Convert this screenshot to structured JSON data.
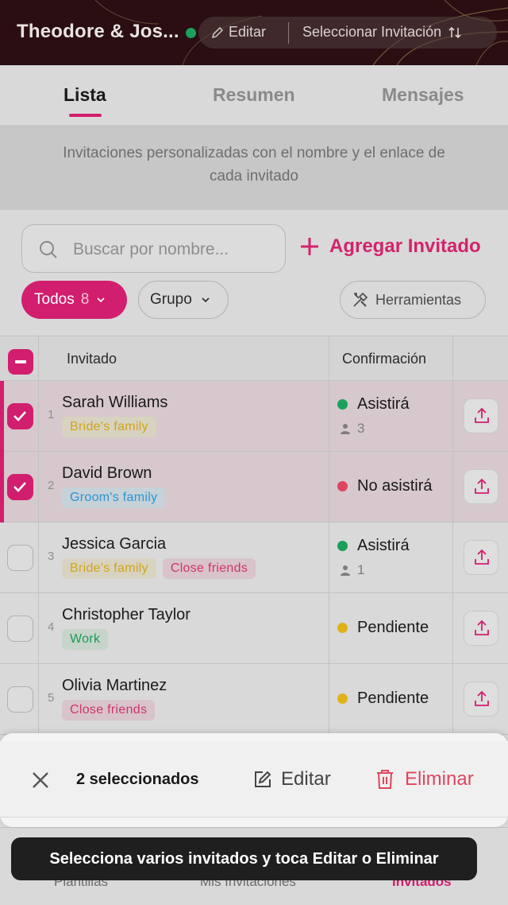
{
  "header": {
    "title": "Theodore & Jos...",
    "edit_label": "Editar",
    "select_invitation_label": "Seleccionar Invitación",
    "status_color": "#1aa05a"
  },
  "tabs": [
    {
      "label": "Lista",
      "active": true
    },
    {
      "label": "Resumen",
      "active": false
    },
    {
      "label": "Mensajes",
      "active": false
    }
  ],
  "description": {
    "line1": "Invitaciones personalizadas con el nombre y el enlace de",
    "line2": "cada invitado"
  },
  "search": {
    "placeholder": "Buscar por nombre..."
  },
  "add_guest_label": "Agregar Invitado",
  "filters": {
    "todos_label": "Todos",
    "todos_count": "8",
    "grupo_label": "Grupo",
    "tools_label": "Herramientas"
  },
  "table": {
    "headers": {
      "guest": "Invitado",
      "confirmation": "Confirmación"
    },
    "rows": [
      {
        "num": "1",
        "name": "Sarah Williams",
        "tags": [
          "Bride's family"
        ],
        "status": "Asistirá",
        "people": "3",
        "selected": true
      },
      {
        "num": "2",
        "name": "David Brown",
        "tags": [
          "Groom's family"
        ],
        "status": "No asistirá",
        "people": "",
        "selected": true
      },
      {
        "num": "3",
        "name": "Jessica Garcia",
        "tags": [
          "Bride's family",
          "Close friends"
        ],
        "status": "Asistirá",
        "people": "1",
        "selected": false
      },
      {
        "num": "4",
        "name": "Christopher Taylor",
        "tags": [
          "Work"
        ],
        "status": "Pendiente",
        "people": "",
        "selected": false
      },
      {
        "num": "5",
        "name": "Olivia Martinez",
        "tags": [
          "Close friends"
        ],
        "status": "Pendiente",
        "people": "",
        "selected": false
      }
    ]
  },
  "status_colors": {
    "attending": "#1aa05a",
    "not_attending": "#e0455e",
    "pending": "#e0b21a"
  },
  "bottom_nav": [
    "Plantillas",
    "Mis Invitaciones",
    "Invitados"
  ],
  "selection_bar": {
    "count_label": "2 seleccionados",
    "edit_label": "Editar",
    "delete_label": "Eliminar"
  },
  "toast": "Selecciona varios invitados y toca Editar o Eliminar"
}
